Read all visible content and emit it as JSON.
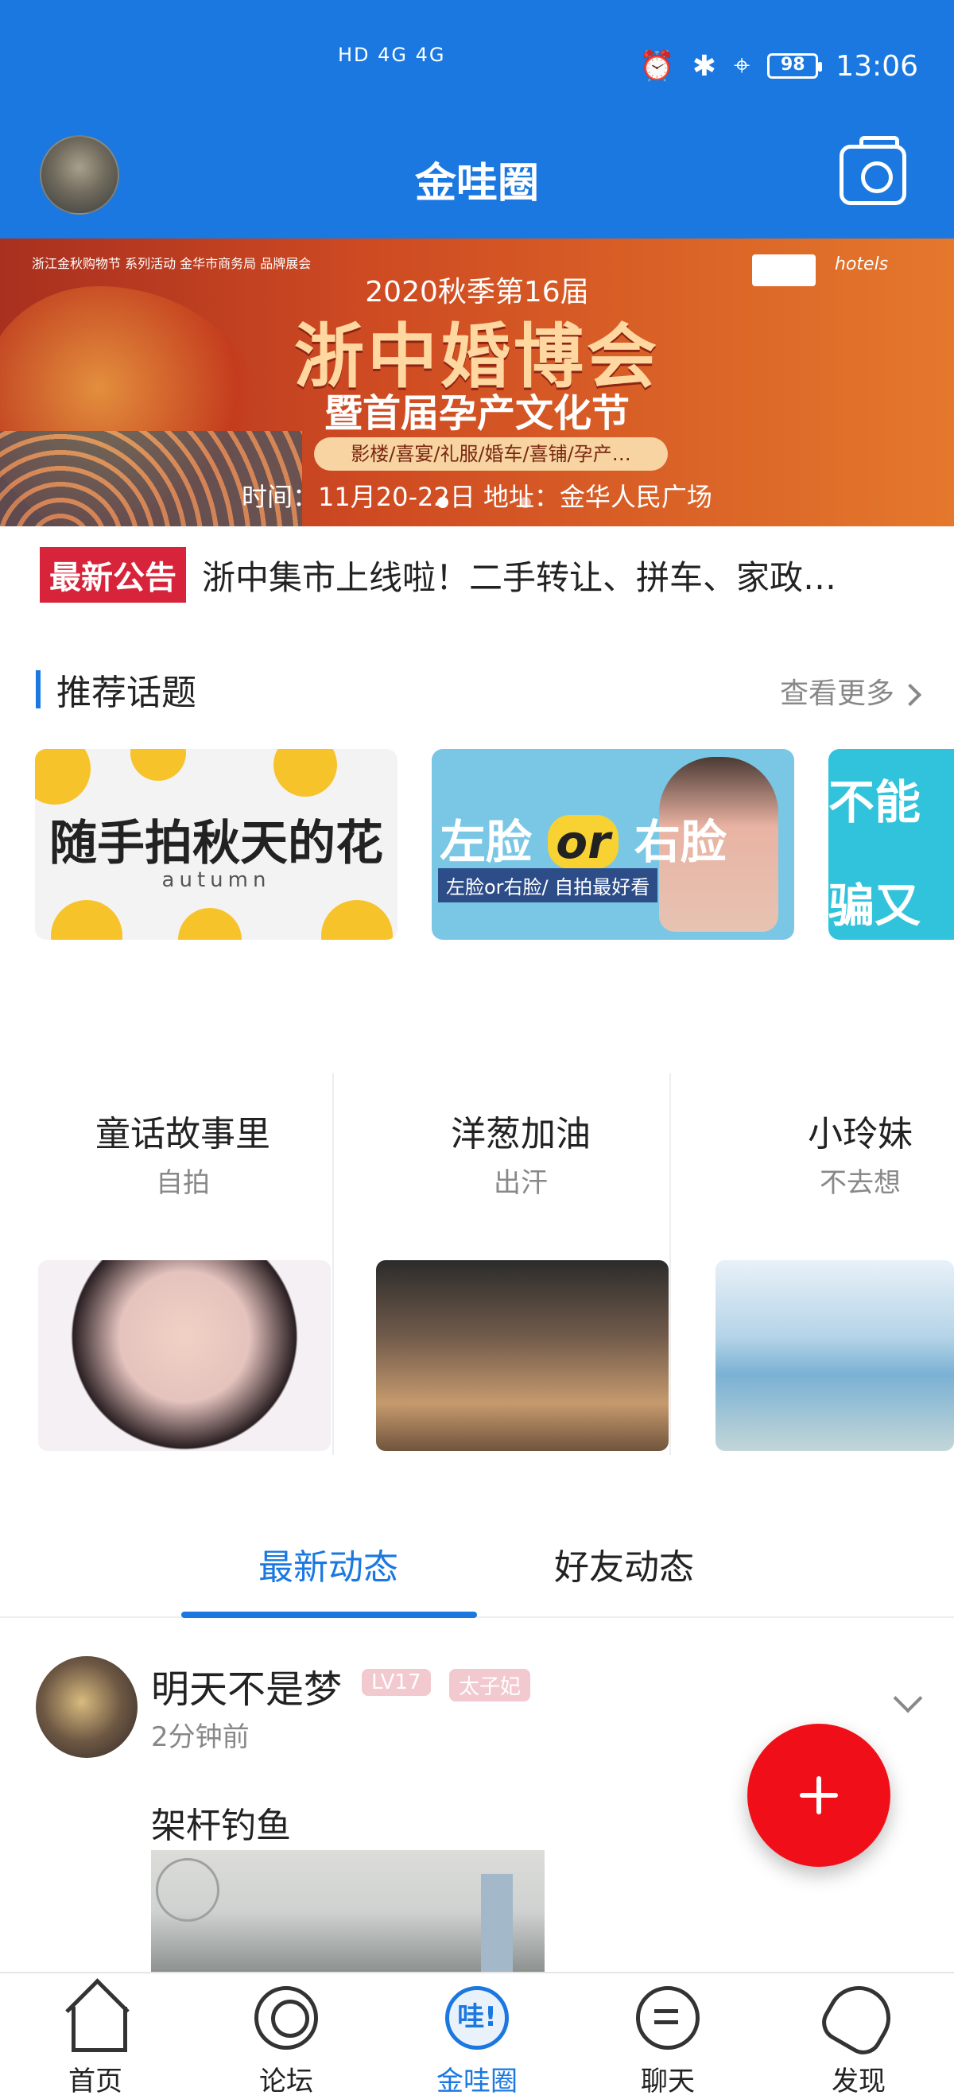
{
  "status": {
    "left_indicators": "HD 4G 4G",
    "battery": "98",
    "time": "13:06"
  },
  "header": {
    "title": "金哇圈"
  },
  "banner": {
    "orgs": "浙江金秋购物节 系列活动\n金华市商务局 品牌展会",
    "sub_top": "2020秋季第16届",
    "main": "浙中婚博会",
    "second": "暨首届孕产文化节",
    "pill": "影楼/喜宴/礼服/婚车/喜铺/孕产…",
    "time_place": "时间：11月20-22日   地址：金华人民广场",
    "logo_b": "hotels"
  },
  "notice": {
    "badge": "最新公告",
    "text": "浙中集市上线啦！二手转让、拼车、家政…"
  },
  "topics": {
    "title": "推荐话题",
    "more": "查看更多",
    "cards": [
      {
        "text": "随手拍秋天的花",
        "sub": "autumn"
      },
      {
        "text_left": "左脸",
        "text_or": "or",
        "text_right": "右脸",
        "tag": "左脸or右脸/ 自拍最好看"
      },
      {
        "text": "不能",
        "text2": "骗又"
      }
    ]
  },
  "people": [
    {
      "name": "童话故事里",
      "desc": "自拍"
    },
    {
      "name": "洋葱加油",
      "desc": "出汗"
    },
    {
      "name": "小玲妹",
      "desc": "不去想"
    }
  ],
  "tabs": [
    {
      "label": "最新动态",
      "active": true
    },
    {
      "label": "好友动态",
      "active": false
    }
  ],
  "post": {
    "username": "明天不是梦",
    "level": "LV17",
    "role": "太子妃",
    "time": "2分钟前",
    "content": "架杆钓鱼"
  },
  "nav": [
    {
      "label": "首页",
      "icon": "home-icon"
    },
    {
      "label": "论坛",
      "icon": "forum-icon"
    },
    {
      "label": "金哇圈",
      "icon": "wa-icon",
      "icon_text": "哇!",
      "active": true
    },
    {
      "label": "聊天",
      "icon": "chat-icon"
    },
    {
      "label": "发现",
      "icon": "rocket-icon"
    }
  ],
  "colors": {
    "brand_blue": "#1a78e0",
    "fab_red": "#f00f18",
    "notice_red": "#d8243a"
  }
}
